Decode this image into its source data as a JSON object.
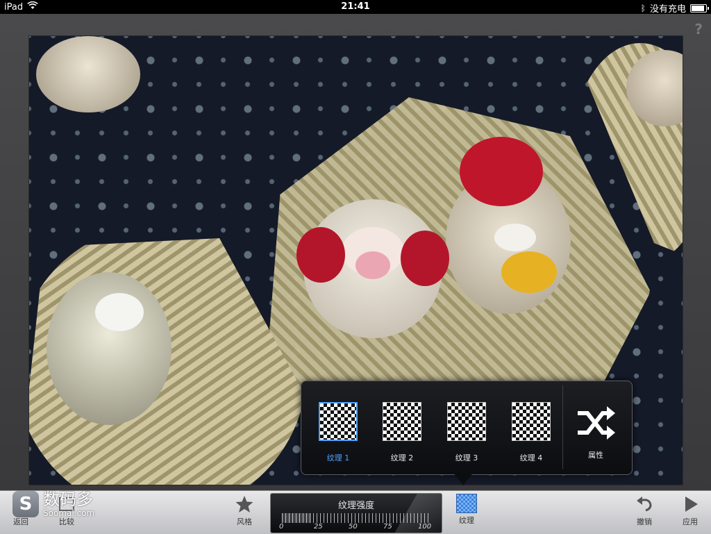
{
  "status_bar": {
    "device": "iPad",
    "time": "21:41",
    "charging": "没有充电"
  },
  "workspace": {
    "help": "?"
  },
  "texture_popover": {
    "items": [
      {
        "label": "纹理 1",
        "selected": true
      },
      {
        "label": "纹理 2",
        "selected": false
      },
      {
        "label": "纹理 3",
        "selected": false
      },
      {
        "label": "纹理 4",
        "selected": false
      }
    ],
    "properties_label": "属性"
  },
  "toolbar": {
    "back_label": "返回",
    "compare_label": "比较",
    "style_label": "风格",
    "texture_label": "纹理",
    "undo_label": "撤销",
    "apply_label": "应用",
    "watermark_cn": "数码多",
    "watermark_en": "Soomal.com",
    "watermark_logo": "S"
  },
  "slider": {
    "title": "纹理强度",
    "ticks": [
      "0",
      "25",
      "50",
      "75",
      "100"
    ],
    "value": 20
  },
  "colors": {
    "accent": "#4fa3ff"
  }
}
